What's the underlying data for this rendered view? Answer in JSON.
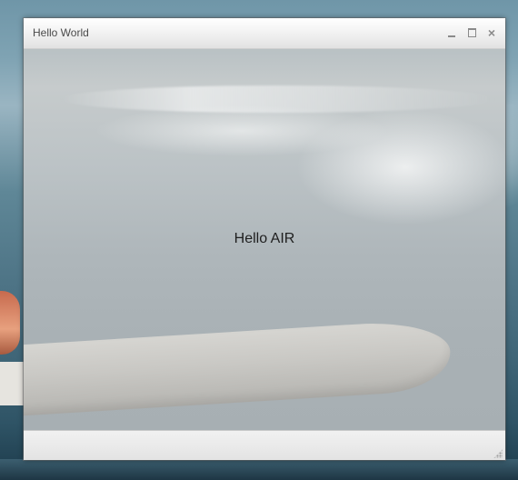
{
  "window": {
    "title": "Hello World",
    "controls": {
      "minimize_icon": "minimize-icon",
      "maximize_icon": "maximize-icon",
      "close_icon": "close-icon",
      "close_glyph": "×"
    }
  },
  "content": {
    "message": "Hello AIR"
  },
  "statusbar": {
    "grip_icon": "resize-grip-icon"
  }
}
